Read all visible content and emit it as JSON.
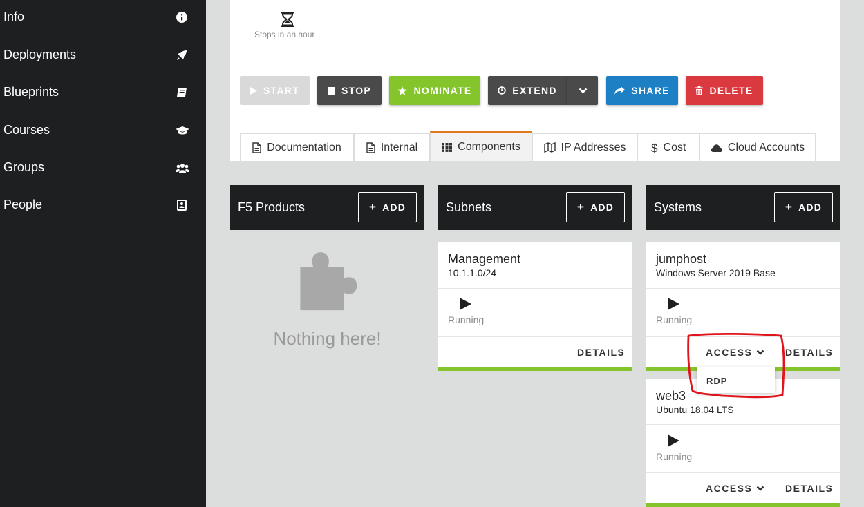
{
  "sidebar": {
    "items": [
      {
        "label": "Info",
        "icon": "info-icon"
      },
      {
        "label": "Deployments",
        "icon": "rocket-icon"
      },
      {
        "label": "Blueprints",
        "icon": "book-icon"
      },
      {
        "label": "Courses",
        "icon": "graduation-cap-icon"
      },
      {
        "label": "Groups",
        "icon": "users-icon"
      },
      {
        "label": "People",
        "icon": "address-book-icon"
      }
    ]
  },
  "status": {
    "icon": "hourglass-icon",
    "text": "Stops in an hour"
  },
  "actions": {
    "start": "START",
    "stop": "STOP",
    "nominate": "NOMINATE",
    "extend": "EXTEND",
    "share": "SHARE",
    "delete": "DELETE"
  },
  "tabs": [
    {
      "label": "Documentation",
      "icon": "file-icon",
      "active": false
    },
    {
      "label": "Internal",
      "icon": "file-text-icon",
      "active": false
    },
    {
      "label": "Components",
      "icon": "grid-icon",
      "active": true
    },
    {
      "label": "IP Addresses",
      "icon": "map-icon",
      "active": false
    },
    {
      "label": "Cost",
      "icon": "dollar-icon",
      "active": false
    },
    {
      "label": "Cloud Accounts",
      "icon": "cloud-icon",
      "active": false
    }
  ],
  "columns": {
    "f5": {
      "title": "F5 Products",
      "add": "ADD",
      "empty_text": "Nothing here!"
    },
    "subnets": {
      "title": "Subnets",
      "add": "ADD",
      "cards": [
        {
          "name": "Management",
          "sub": "10.1.1.0/24",
          "state": "Running",
          "details": "DETAILS"
        }
      ]
    },
    "systems": {
      "title": "Systems",
      "add": "ADD",
      "cards": [
        {
          "name": "jumphost",
          "sub": "Windows Server 2019 Base",
          "state": "Running",
          "access": "ACCESS",
          "details": "DETAILS"
        },
        {
          "name": "web3",
          "sub": "Ubuntu 18.04 LTS",
          "state": "Running",
          "access": "ACCESS",
          "details": "DETAILS"
        }
      ],
      "access_menu": [
        "RDP"
      ]
    }
  },
  "colors": {
    "sidebar_bg": "#1e1f21",
    "accent_green": "#84c52c",
    "share_blue": "#1d7fc4",
    "delete_red": "#d9393f",
    "tab_active_border": "#e07b1c",
    "annotation_red": "#e0141b"
  }
}
